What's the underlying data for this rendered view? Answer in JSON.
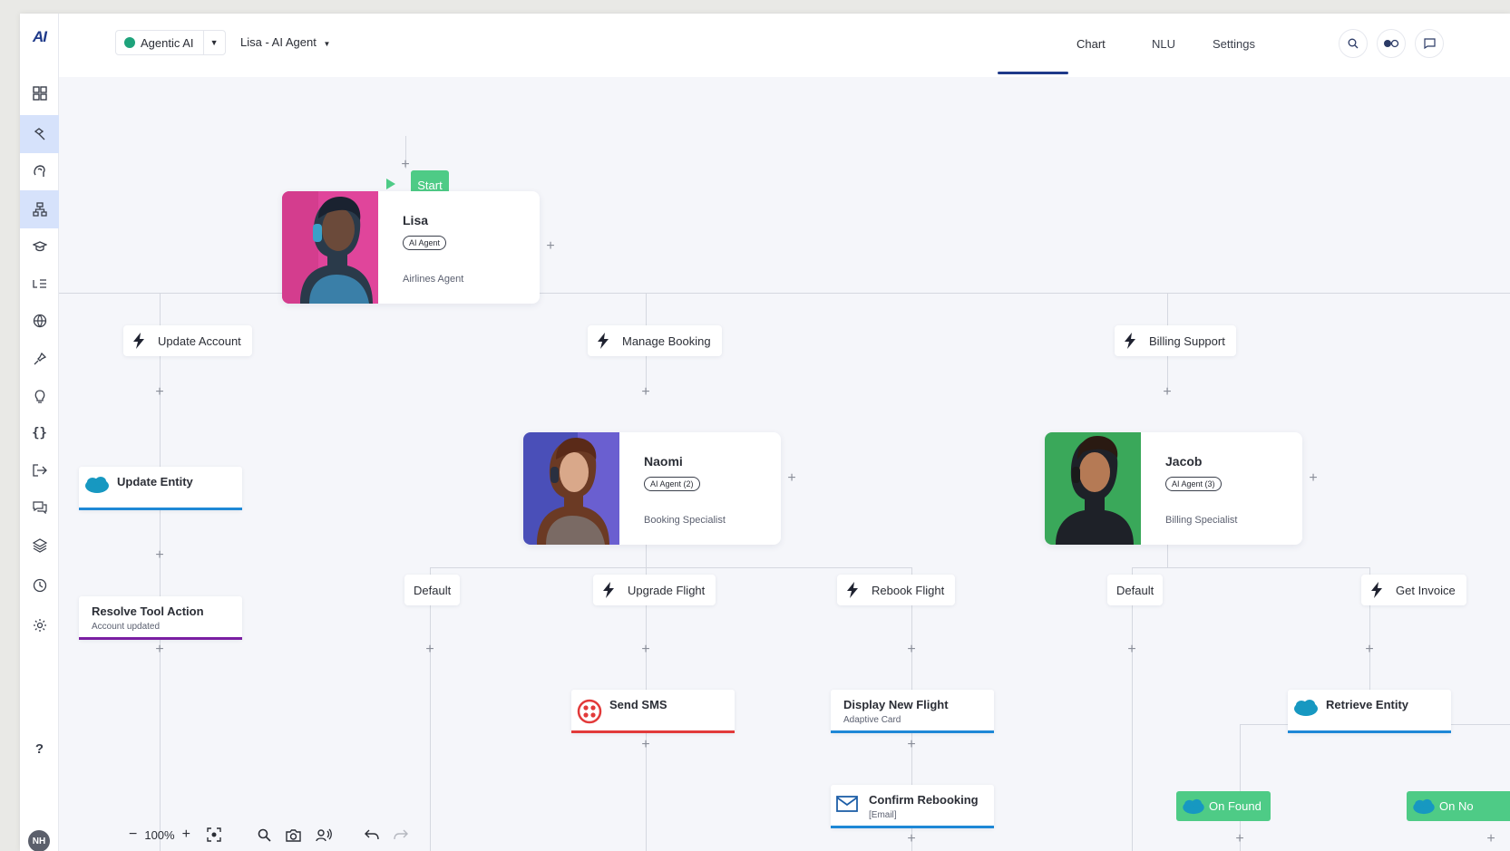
{
  "app": {
    "logo": "AI"
  },
  "sidebar": {
    "items": [
      {
        "icon": "grid-icon"
      },
      {
        "icon": "hammer-icon"
      },
      {
        "icon": "brain-icon"
      },
      {
        "icon": "flow-icon"
      },
      {
        "icon": "graduation-cap-icon"
      },
      {
        "icon": "list-icon"
      },
      {
        "icon": "globe-icon"
      },
      {
        "icon": "pin-icon"
      },
      {
        "icon": "bulb-icon"
      },
      {
        "icon": "braces-icon"
      },
      {
        "icon": "logout-icon"
      },
      {
        "icon": "chat-icon"
      },
      {
        "icon": "layers-icon"
      },
      {
        "icon": "clock-icon"
      },
      {
        "icon": "gear-icon"
      }
    ],
    "help_label": "?",
    "avatar_initials": "NH"
  },
  "header": {
    "project_name": "Agentic AI",
    "project_status_color": "#1ea37b",
    "agent_selector": "Lisa - AI Agent",
    "tabs": [
      {
        "label": "Chart",
        "active": true
      },
      {
        "label": "NLU",
        "active": false
      },
      {
        "label": "Settings",
        "active": false
      }
    ]
  },
  "canvas": {
    "start_label": "Start",
    "agents": {
      "lisa": {
        "name": "Lisa",
        "badge": "AI Agent",
        "role": "Airlines Agent"
      },
      "naomi": {
        "name": "Naomi",
        "badge": "AI Agent (2)",
        "role": "Booking Specialist"
      },
      "jacob": {
        "name": "Jacob",
        "badge": "AI Agent (3)",
        "role": "Billing Specialist"
      }
    },
    "triggers": {
      "update_account": "Update Account",
      "manage_booking": "Manage Booking",
      "billing_support": "Billing Support",
      "naomi_default": "Default",
      "upgrade_flight": "Upgrade Flight",
      "rebook_flight": "Rebook Flight",
      "jacob_default": "Default",
      "get_invoice": "Get Invoice"
    },
    "nodes": {
      "update_entity": {
        "title": "Update Entity",
        "bar_color": "#1e88d6"
      },
      "resolve_tool": {
        "title": "Resolve Tool Action",
        "subtitle": "Account updated",
        "bar_color": "#7a1fa2"
      },
      "send_sms": {
        "title": "Send SMS",
        "bar_color": "#e23a3a"
      },
      "display_flight": {
        "title": "Display New Flight",
        "subtitle": "Adaptive Card",
        "bar_color": "#1e88d6"
      },
      "confirm_rebooking": {
        "title": "Confirm Rebooking",
        "subtitle": "[Email]",
        "bar_color": "#1e88d6"
      },
      "retrieve_entity": {
        "title": "Retrieve Entity",
        "bar_color": "#1e88d6"
      }
    },
    "outcomes": {
      "on_found": "On Found",
      "on_not_found": "On No"
    }
  },
  "zoom": {
    "level": "100%"
  }
}
